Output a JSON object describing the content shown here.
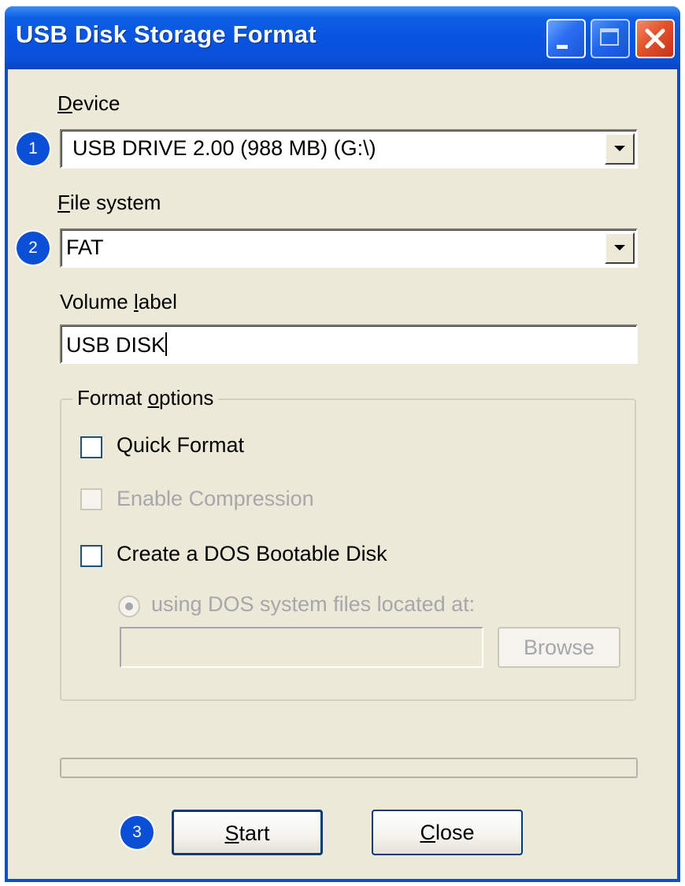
{
  "window": {
    "title": "USB Disk Storage Format"
  },
  "device": {
    "label": "Device",
    "underline_char": "D",
    "label_rest": "evice",
    "selected": "USB DRIVE 2.00 (988 MB) (G:\\)"
  },
  "file_system": {
    "label": "File system",
    "underline_char": "F",
    "label_rest": "ile system",
    "selected": "FAT"
  },
  "volume_label": {
    "label": "Volume label",
    "label_pre": "Volume ",
    "underline_char": "l",
    "label_rest": "abel",
    "value": "USB DISK"
  },
  "format_options": {
    "legend": "Format options",
    "legend_pre": "Format ",
    "underline_char": "o",
    "legend_rest": "ptions",
    "quick_format": {
      "label": "Quick Format",
      "checked": false,
      "enabled": true
    },
    "enable_compression": {
      "label": "Enable Compression",
      "checked": false,
      "enabled": false
    },
    "dos_bootable": {
      "label": "Create a DOS Bootable Disk",
      "checked": false,
      "enabled": true
    },
    "dos_files_radio": {
      "label": "using DOS system files located at:",
      "selected": true,
      "enabled": false
    },
    "dos_path": {
      "value": ""
    },
    "browse_label": "Browse"
  },
  "progress": {
    "fraction": 0
  },
  "buttons": {
    "start_underline": "S",
    "start_rest": "tart",
    "start_label": "Start",
    "close_underline": "C",
    "close_rest": "lose",
    "close_label": "Close"
  },
  "callouts": [
    "1",
    "2",
    "3"
  ],
  "colors": {
    "titlebar": "#0753e0",
    "client_bg": "#ece9d8",
    "callout_badge": "#0b4fd6",
    "disabled_text": "#a7a6aa"
  },
  "icons": {
    "minimize": "minimize-icon",
    "maximize": "maximize-icon",
    "close": "close-x-icon",
    "dropdown": "chevron-down-icon"
  }
}
